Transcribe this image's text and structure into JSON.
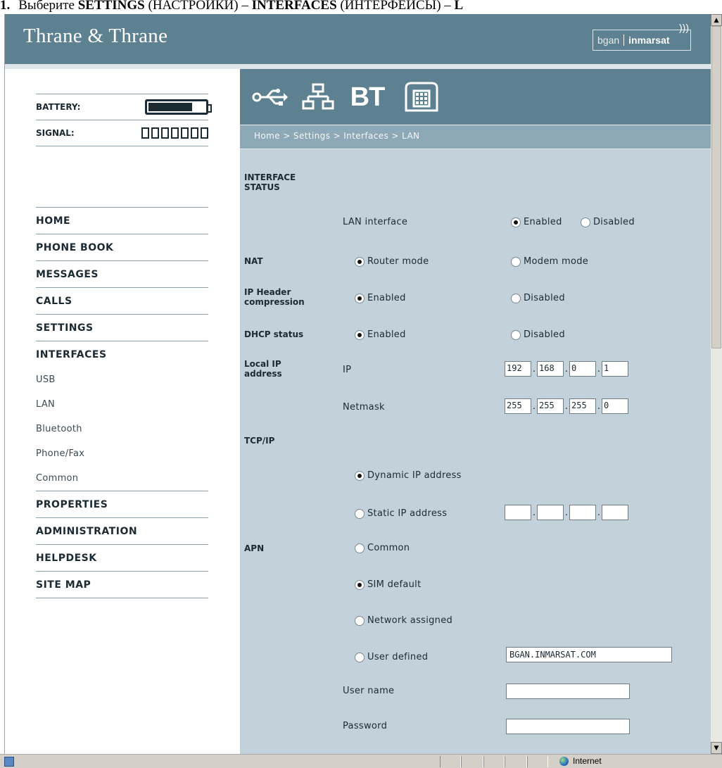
{
  "doc_heading": {
    "number": "1.",
    "text_pre": "Выберите ",
    "settings": "SETTINGS",
    "settings_ru": " (НАСТРОЙКИ) – ",
    "interfaces": "INTERFACES",
    "interfaces_ru": " (ИНТЕРФЕЙСЫ) – ",
    "trailing": "L"
  },
  "banner": {
    "brand": "Thrane & Thrane",
    "logo_left": "bgan",
    "logo_right": "inmarsat"
  },
  "status": {
    "battery_label": "BATTERY:",
    "battery_level": 0.88,
    "signal_label": "SIGNAL:",
    "signal_bars_lit": 0,
    "signal_bars_total": 7
  },
  "nav": {
    "items": [
      {
        "label": "HOME",
        "sub": false
      },
      {
        "label": "PHONE BOOK",
        "sub": false
      },
      {
        "label": "MESSAGES",
        "sub": false
      },
      {
        "label": "CALLS",
        "sub": false
      },
      {
        "label": "SETTINGS",
        "sub": false
      },
      {
        "label": "INTERFACES",
        "sub": false
      },
      {
        "label": "USB",
        "sub": true
      },
      {
        "label": "LAN",
        "sub": true
      },
      {
        "label": "Bluetooth",
        "sub": true
      },
      {
        "label": "Phone/Fax",
        "sub": true
      },
      {
        "label": "Common",
        "sub": true
      },
      {
        "label": "PROPERTIES",
        "sub": false
      },
      {
        "label": "ADMINISTRATION",
        "sub": false
      },
      {
        "label": "HELPDESK",
        "sub": false
      },
      {
        "label": "SITE MAP",
        "sub": false
      }
    ]
  },
  "iconbar": {
    "bt_label": "BT",
    "icons": [
      "usb-icon",
      "lan-icon",
      "bluetooth-icon",
      "phone-fax-icon"
    ]
  },
  "breadcrumb": "Home > Settings > Interfaces > LAN",
  "form": {
    "interface_status_label": "INTERFACE STATUS",
    "lan_interface_label": "LAN interface",
    "lan_enabled": "Enabled",
    "lan_disabled": "Disabled",
    "nat_label": "NAT",
    "nat_router": "Router mode",
    "nat_modem": "Modem mode",
    "iphc_label": "IP Header compression",
    "iphc_enabled": "Enabled",
    "iphc_disabled": "Disabled",
    "dhcp_label": "DHCP status",
    "dhcp_enabled": "Enabled",
    "dhcp_disabled": "Disabled",
    "local_ip_label": "Local IP address",
    "ip_label": "IP",
    "ip": [
      "192",
      "168",
      "0",
      "1"
    ],
    "netmask_label": "Netmask",
    "netmask": [
      "255",
      "255",
      "255",
      "0"
    ],
    "tcpip_label": "TCP/IP",
    "dynamic_ip": "Dynamic IP address",
    "static_ip": "Static IP address",
    "static_ip_value": [
      "",
      "",
      "",
      ""
    ],
    "apn_label": "APN",
    "apn_common": "Common",
    "apn_sim": "SIM default",
    "apn_network": "Network assigned",
    "apn_user": "User defined",
    "apn_user_value": "BGAN.INMARSAT.COM",
    "username_label": "User name",
    "username_value": "",
    "password_label": "Password",
    "password_value": ""
  },
  "browser_status": {
    "zone": "Internet"
  }
}
